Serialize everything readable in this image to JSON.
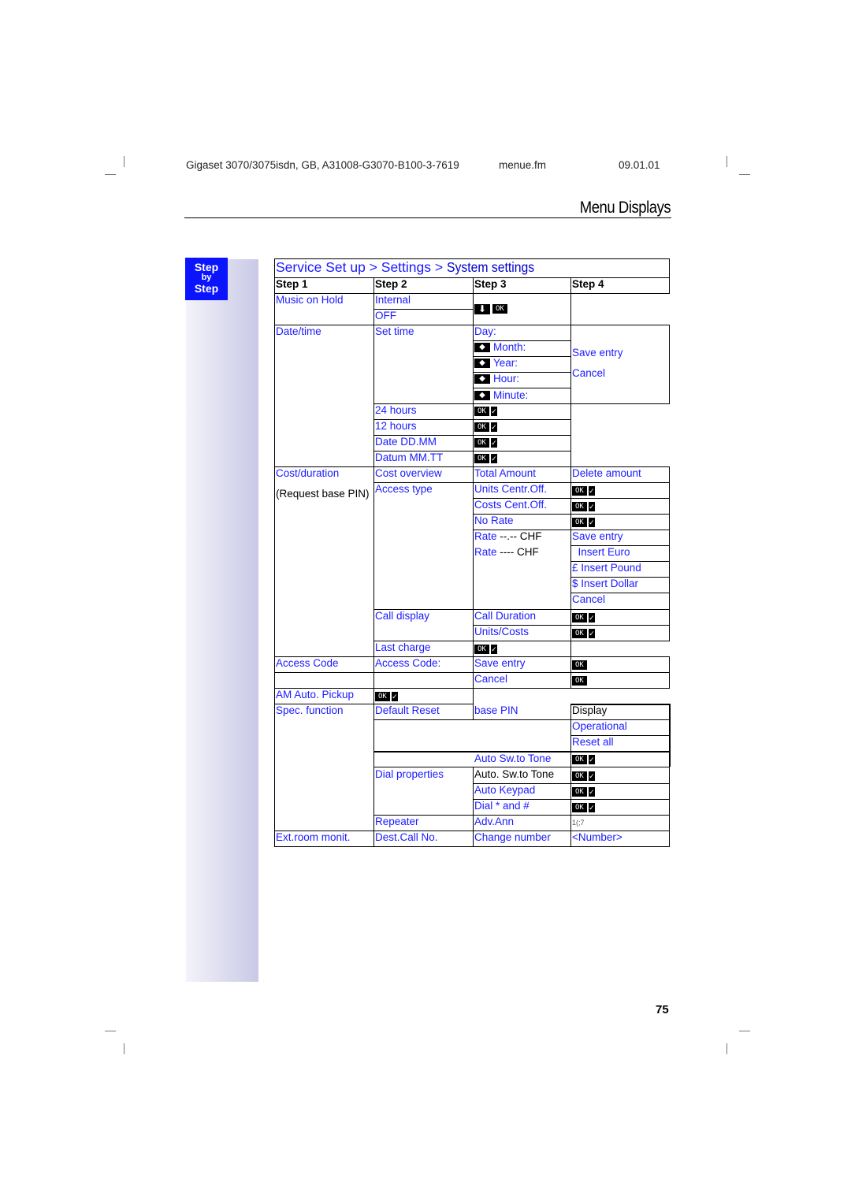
{
  "header": {
    "doc_id": "Gigaset 3070/3075isdn, GB, A31008-G3070-B100-3-7619",
    "file": "menue.fm",
    "date": "09.01.01"
  },
  "page_title": "Menu Displays",
  "step_badge": {
    "line1": "Step",
    "line2": "by",
    "line3": "Step"
  },
  "breadcrumb": {
    "part1": "Service Set up",
    "sep1": " > ",
    "part2": "Settings",
    "sep2": " > ",
    "part3": "System settings"
  },
  "columns": [
    "Step 1",
    "Step 2",
    "Step 3",
    "Step 4"
  ],
  "keys": {
    "ok": "OK",
    "check": "✓",
    "arrow_right": "◆",
    "arrow_down": "⬇"
  },
  "rows": {
    "music_on_hold": {
      "s1": "Music on Hold",
      "s2a": "Internal",
      "s2b": "OFF"
    },
    "date_time": {
      "s1": "Date/time",
      "s2": "Set time",
      "s3": [
        "Day:",
        "Month:",
        "Year:",
        "Hour:",
        "Minute:"
      ],
      "s4a": "Save entry",
      "s4b": "Cancel",
      "formats": [
        "24 hours",
        "12 hours",
        "Date DD.MM",
        "Datum MM.TT"
      ]
    },
    "cost_duration": {
      "s1": "Cost/duration",
      "s1_note": "(Request base PIN)",
      "cost_overview": "Cost overview",
      "total_amount": "Total Amount",
      "delete_amount": "Delete amount",
      "access_type": "Access type",
      "access_options": [
        "Units Centr.Off.",
        "Costs Cent.Off.",
        "No Rate"
      ],
      "rate1_label": "Rate",
      "rate1_suffix": " --.-- CHF",
      "rate2_label": "Rate",
      "rate2_suffix": " ---- CHF",
      "rate_actions": [
        "Save entry",
        "  Insert Euro",
        "£ Insert Pound",
        "$ Insert Dollar",
        "Cancel"
      ],
      "call_display": "Call display",
      "call_display_options": [
        "Call Duration",
        "Units/Costs"
      ],
      "last_charge": "Last charge"
    },
    "access_code": {
      "s1": "Access Code",
      "s2": "Access Code:",
      "s3a": "Save entry",
      "s3b": "Cancel"
    },
    "am_auto_pickup": {
      "s1": "AM Auto. Pickup"
    },
    "spec_function": {
      "s1": "Spec. function",
      "s2": "Default Reset",
      "s3": "base PIN",
      "s4": [
        "Display",
        "Operational",
        "Reset all"
      ],
      "auto_sw": "Auto Sw.to Tone",
      "dial_properties": "Dial properties",
      "dial_options": [
        "Auto. Sw.to Tone",
        "Auto Keypad",
        "Dial * and #"
      ],
      "repeater": "Repeater",
      "adv_ann": "Adv.Ann",
      "adv_ann_s4": "1(;7"
    },
    "ext_room": {
      "s1": "Ext.room monit.",
      "s2": "Dest.Call No.",
      "s3": "Change number",
      "s4": "<Number>"
    }
  },
  "page_number": "75"
}
